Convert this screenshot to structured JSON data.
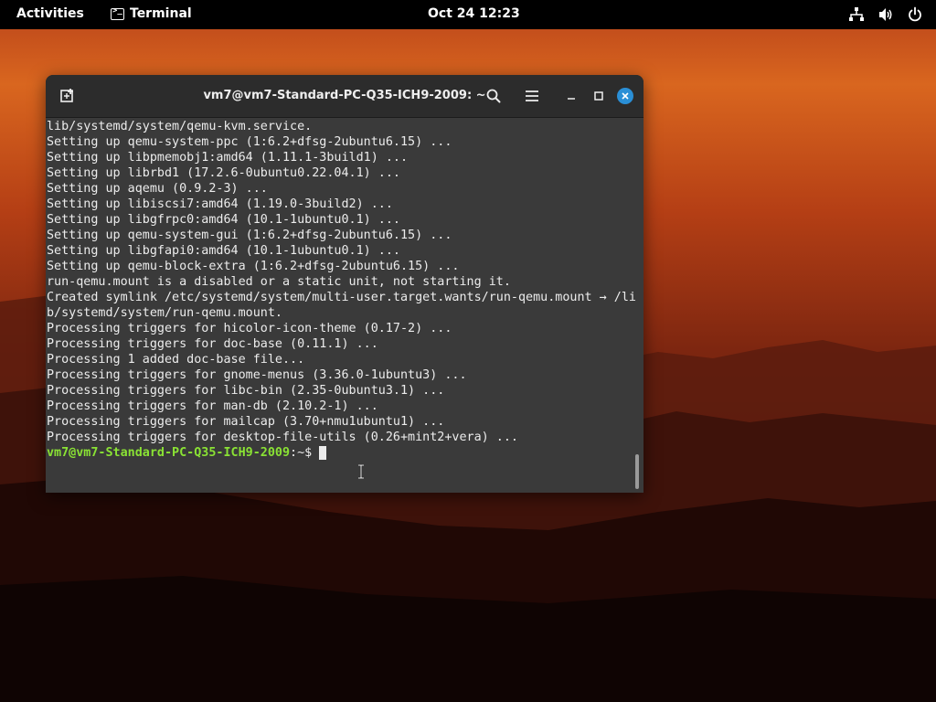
{
  "topbar": {
    "activities_label": "Activities",
    "app_name": "Terminal",
    "clock": "Oct 24  12:23",
    "tray_icons": [
      "network-icon",
      "volume-icon",
      "power-icon"
    ]
  },
  "terminal": {
    "title": "vm7@vm7-Standard-PC-Q35-ICH9-2009: ~",
    "output_lines": [
      "lib/systemd/system/qemu-kvm.service.",
      "Setting up qemu-system-ppc (1:6.2+dfsg-2ubuntu6.15) ...",
      "Setting up libpmemobj1:amd64 (1.11.1-3build1) ...",
      "Setting up librbd1 (17.2.6-0ubuntu0.22.04.1) ...",
      "Setting up aqemu (0.9.2-3) ...",
      "Setting up libiscsi7:amd64 (1.19.0-3build2) ...",
      "Setting up libgfrpc0:amd64 (10.1-1ubuntu0.1) ...",
      "Setting up qemu-system-gui (1:6.2+dfsg-2ubuntu6.15) ...",
      "Setting up libgfapi0:amd64 (10.1-1ubuntu0.1) ...",
      "Setting up qemu-block-extra (1:6.2+dfsg-2ubuntu6.15) ...",
      "run-qemu.mount is a disabled or a static unit, not starting it.",
      "Created symlink /etc/systemd/system/multi-user.target.wants/run-qemu.mount → /li",
      "b/systemd/system/run-qemu.mount.",
      "Processing triggers for hicolor-icon-theme (0.17-2) ...",
      "Processing triggers for doc-base (0.11.1) ...",
      "Processing 1 added doc-base file...",
      "Processing triggers for gnome-menus (3.36.0-1ubuntu3) ...",
      "Processing triggers for libc-bin (2.35-0ubuntu3.1) ...",
      "Processing triggers for man-db (2.10.2-1) ...",
      "Processing triggers for mailcap (3.70+nmu1ubuntu1) ...",
      "Processing triggers for desktop-file-utils (0.26+mint2+vera) ..."
    ],
    "prompt_user": "vm7@vm7-Standard-PC-Q35-ICH9-2009",
    "prompt_suffix": ":~$ "
  },
  "colors": {
    "prompt_green": "#8ae234",
    "terminal_bg": "#3a3a3a",
    "close_blue": "#2a8fd6"
  }
}
